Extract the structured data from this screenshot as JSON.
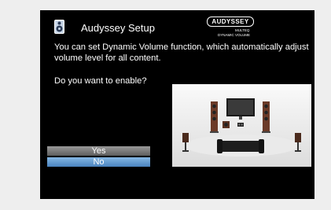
{
  "header": {
    "icon": "speaker-icon",
    "title": "Audyssey Setup",
    "logo": {
      "brand": "AUDYSSEY",
      "line1": "MULTEQ",
      "line2": "DYNAMIC VOLUME"
    }
  },
  "message": "You can set Dynamic Volume function, which automatically adjust volume level for all content.",
  "question": "Do you want to enable?",
  "options": [
    {
      "label": "Yes",
      "selected": false
    },
    {
      "label": "No",
      "selected": true
    }
  ],
  "illustration": "home-theater-speakers-illustration",
  "colors": {
    "screen_bg": "#000000",
    "page_bg": "#eeeeee",
    "highlight": "#6aa0d8",
    "button": "#7c7c7c"
  }
}
